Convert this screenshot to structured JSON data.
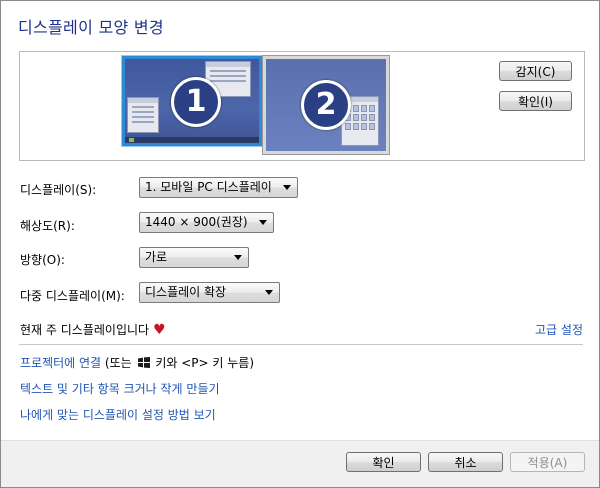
{
  "window": {
    "title": "디스플레이 모양 변경"
  },
  "preview": {
    "monitors": [
      {
        "number": "1",
        "selected": true
      },
      {
        "number": "2",
        "selected": false
      }
    ],
    "detect_label": "감지(C)",
    "identify_label": "확인(I)"
  },
  "settings": {
    "display": {
      "label": "디스플레이(S):",
      "value": "1. 모바일 PC 디스플레이"
    },
    "resolution": {
      "label": "해상도(R):",
      "value": "1440 × 900(권장)"
    },
    "orientation": {
      "label": "방향(O):",
      "value": "가로"
    },
    "multiple": {
      "label": "다중 디스플레이(M):",
      "value": "디스플레이 확장"
    }
  },
  "status": {
    "primary_text": "현재 주 디스플레이입니다",
    "advanced_link": "고급 설정"
  },
  "links": {
    "projector_link": "프로젝터에 연결",
    "projector_hint_pre": " (또는 ",
    "projector_hint_post": " 키와 <P> 키 누름)",
    "text_size_link": "텍스트 및 기타 항목 크거나 작게 만들기",
    "help_link": "나에게 맞는 디스플레이 설정 방법 보기"
  },
  "buttons": {
    "ok": "확인",
    "cancel": "취소",
    "apply": "적용(A)"
  },
  "colors": {
    "title": "#1e3287",
    "link": "#1f55b5",
    "selected_border": "#2f8ad6",
    "heart": "#c81522"
  }
}
